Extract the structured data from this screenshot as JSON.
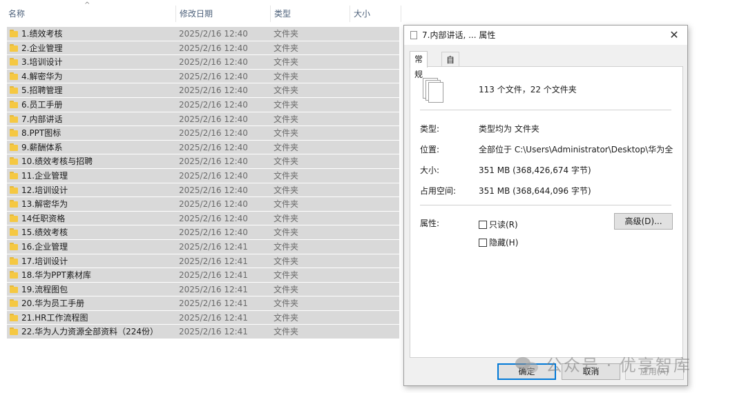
{
  "explorer": {
    "columns": {
      "name": "名称",
      "date": "修改日期",
      "type": "类型",
      "size": "大小"
    },
    "sort_indicator": "^",
    "rows": [
      {
        "name": "1.绩效考核",
        "date": "2025/2/16 12:40",
        "type": "文件夹"
      },
      {
        "name": "2.企业管理",
        "date": "2025/2/16 12:40",
        "type": "文件夹"
      },
      {
        "name": "3.培训设计",
        "date": "2025/2/16 12:40",
        "type": "文件夹"
      },
      {
        "name": "4.解密华为",
        "date": "2025/2/16 12:40",
        "type": "文件夹"
      },
      {
        "name": "5.招聘管理",
        "date": "2025/2/16 12:40",
        "type": "文件夹"
      },
      {
        "name": "6.员工手册",
        "date": "2025/2/16 12:40",
        "type": "文件夹"
      },
      {
        "name": "7.内部讲话",
        "date": "2025/2/16 12:40",
        "type": "文件夹"
      },
      {
        "name": "8.PPT图标",
        "date": "2025/2/16 12:40",
        "type": "文件夹"
      },
      {
        "name": "9.薪酬体系",
        "date": "2025/2/16 12:40",
        "type": "文件夹"
      },
      {
        "name": "10.绩效考核与招聘",
        "date": "2025/2/16 12:40",
        "type": "文件夹"
      },
      {
        "name": "11.企业管理",
        "date": "2025/2/16 12:40",
        "type": "文件夹"
      },
      {
        "name": "12.培训设计",
        "date": "2025/2/16 12:40",
        "type": "文件夹"
      },
      {
        "name": "13.解密华为",
        "date": "2025/2/16 12:40",
        "type": "文件夹"
      },
      {
        "name": "14任职资格",
        "date": "2025/2/16 12:40",
        "type": "文件夹"
      },
      {
        "name": "15.绩效考核",
        "date": "2025/2/16 12:40",
        "type": "文件夹"
      },
      {
        "name": "16.企业管理",
        "date": "2025/2/16 12:41",
        "type": "文件夹"
      },
      {
        "name": "17.培训设计",
        "date": "2025/2/16 12:41",
        "type": "文件夹"
      },
      {
        "name": "18.华为PPT素材库",
        "date": "2025/2/16 12:41",
        "type": "文件夹"
      },
      {
        "name": "19.流程图包",
        "date": "2025/2/16 12:41",
        "type": "文件夹"
      },
      {
        "name": "20.华为员工手册",
        "date": "2025/2/16 12:41",
        "type": "文件夹"
      },
      {
        "name": "21.HR工作流程图",
        "date": "2025/2/16 12:41",
        "type": "文件夹"
      },
      {
        "name": "22.华为人力资源全部资料（224份）",
        "date": "2025/2/16 12:41",
        "type": "文件夹"
      }
    ]
  },
  "dialog": {
    "title": "7.内部讲话, ... 属性",
    "close": "✕",
    "tabs": [
      "常规",
      "自定义"
    ],
    "active_tab": 0,
    "summary": "113 个文件，22 个文件夹",
    "props": {
      "type_label": "类型:",
      "type_value": "类型均为 文件夹",
      "location_label": "位置:",
      "location_value": "全部位于 C:\\Users\\Administrator\\Desktop\\华为全套资",
      "size_label": "大小:",
      "size_value": "351 MB (368,426,674 字节)",
      "disk_label": "占用空间:",
      "disk_value": "351 MB (368,644,096 字节)",
      "attr_label": "属性:"
    },
    "readonly_label": "只读(R)",
    "readonly_checked": false,
    "hidden_label": "隐藏(H)",
    "hidden_checked": false,
    "advanced_button": "高级(D)...",
    "ok_button": "确定",
    "cancel_button": "取消",
    "apply_button": "应用(A)"
  },
  "watermark": {
    "text": "公众号 · 优享智库"
  },
  "colors": {
    "row_selected": "#d9d9d9",
    "folder": "#f5c842",
    "accent": "#0078d7"
  }
}
